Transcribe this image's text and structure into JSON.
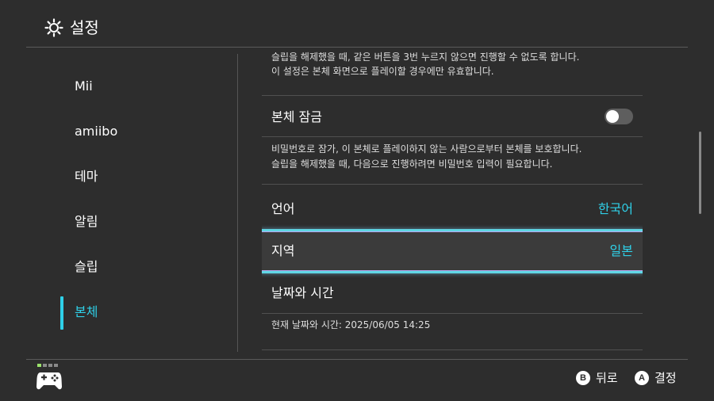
{
  "header": {
    "title": "설정",
    "icon": "gear-icon"
  },
  "sidebar": {
    "items": [
      {
        "label": "Mii"
      },
      {
        "label": "amiibo"
      },
      {
        "label": "테마"
      },
      {
        "label": "알림"
      },
      {
        "label": "슬립"
      },
      {
        "label": "본체"
      }
    ],
    "active_index": 5
  },
  "content": {
    "top_desc_line1": "슬립을 해제했을 때, 같은 버튼을 3번 누르지 않으면 진행할 수 없도록 합니다.",
    "top_desc_line2": "이 설정은 본체 화면으로 플레이할 경우에만 유효합니다.",
    "console_lock": {
      "label": "본체 잠금",
      "toggle_on": false,
      "desc_line1": "비밀번호로 잠가, 이 본체로 플레이하지 않는 사람으로부터 본체를 보호합니다.",
      "desc_line2": "슬립을 해제했을 때, 다음으로 진행하려면 비밀번호 입력이 필요합니다."
    },
    "language": {
      "label": "언어",
      "value": "한국어"
    },
    "region": {
      "label": "지역",
      "value": "일본"
    },
    "datetime": {
      "label": "날짜와 시간",
      "current": "현재 날짜와 시간: 2025/06/05 14:25"
    }
  },
  "footer": {
    "back": {
      "glyph": "B",
      "label": "뒤로"
    },
    "confirm": {
      "glyph": "A",
      "label": "결정"
    }
  },
  "colors": {
    "accent": "#2fd0e8",
    "background": "#2d2d2d"
  }
}
